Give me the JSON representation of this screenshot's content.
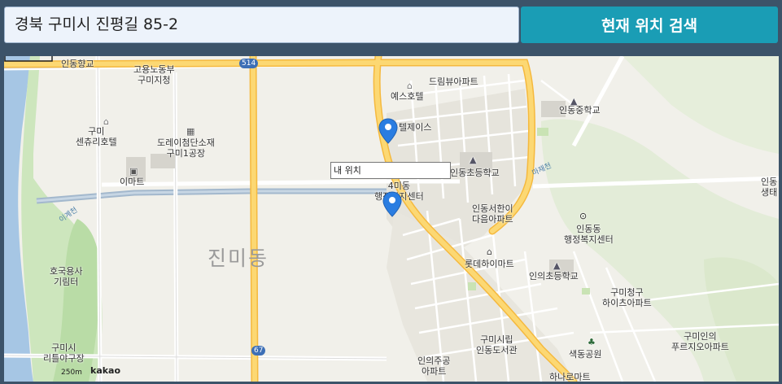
{
  "search": {
    "value": "경북 구미시 진평길 85-2",
    "button_label": "현재 위치 검색"
  },
  "map": {
    "popup_text": "내 위치",
    "area_label": "진미동",
    "scale_text": "250m",
    "brand": "kakao",
    "road_shields": [
      "514",
      "67"
    ],
    "stream_labels": [
      "마재천",
      "이계천"
    ],
    "places": [
      {
        "lines": [
          "인동향교"
        ]
      },
      {
        "lines": [
          "고용노동부",
          "구미지청"
        ]
      },
      {
        "lines": [
          "드림뷰아파트"
        ]
      },
      {
        "lines": [
          "예스호텔"
        ]
      },
      {
        "lines": [
          "텔제이스"
        ]
      },
      {
        "lines": [
          "인동중학교"
        ]
      },
      {
        "lines": [
          "구미",
          "센츄리호텔"
        ]
      },
      {
        "lines": [
          "도레이첨단소재",
          "구미1공장"
        ]
      },
      {
        "lines": [
          "이마트"
        ]
      },
      {
        "lines": [
          "인동초등학교"
        ]
      },
      {
        "lines": [
          "4미동",
          "행정복지센터"
        ]
      },
      {
        "lines": [
          "인동서한이",
          "다음아파트"
        ]
      },
      {
        "lines": [
          "인동동",
          "행정복지센터"
        ]
      },
      {
        "lines": [
          "롯데하이마트"
        ]
      },
      {
        "lines": [
          "인의초등학교"
        ]
      },
      {
        "lines": [
          "호국용사",
          "기림터"
        ]
      },
      {
        "lines": [
          "구미청구",
          "하이츠아파트"
        ]
      },
      {
        "lines": [
          "구미시립",
          "인동도서관"
        ]
      },
      {
        "lines": [
          "구미인의",
          "푸르지오아파트"
        ]
      },
      {
        "lines": [
          "구미시",
          "리틀야구장"
        ]
      },
      {
        "lines": [
          "인의주공",
          "아파트"
        ]
      },
      {
        "lines": [
          "색동공원"
        ]
      },
      {
        "lines": [
          "하나로마트"
        ]
      },
      {
        "lines": [
          "인동",
          "생태"
        ]
      }
    ]
  },
  "colors": {
    "header_bg": "#3c5369",
    "button_bg": "#1a9db5",
    "input_bg": "#edf3fb",
    "marker": "#2a7de1",
    "main_road": "#fccf5e"
  },
  "icons": [
    "location-marker-icon",
    "hotel-icon",
    "factory-icon",
    "mart-icon",
    "school-icon",
    "office-icon",
    "park-icon"
  ]
}
